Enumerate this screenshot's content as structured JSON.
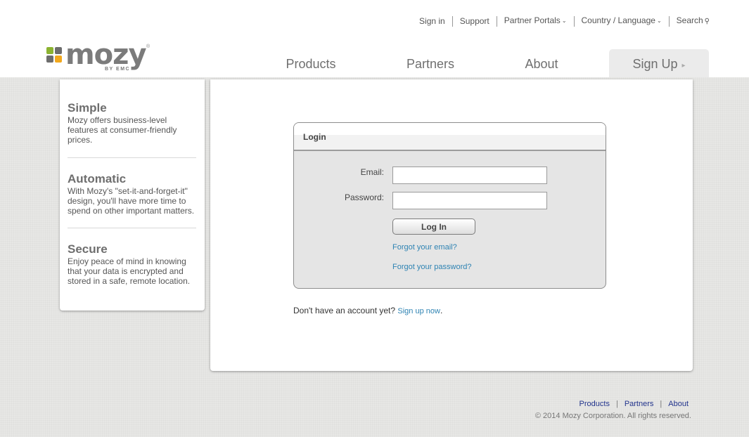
{
  "utility_nav": {
    "sign_in": "Sign in",
    "support": "Support",
    "partner_portals": "Partner Portals",
    "country_language": "Country / Language",
    "search": "Search"
  },
  "logo": {
    "wordmark": "mozy",
    "byline": "BY EMC",
    "registered": "®",
    "square_colors": [
      "#8cb331",
      "#6d6d6d",
      "#6d6d6d",
      "#f2a81d"
    ]
  },
  "main_nav": {
    "products": "Products",
    "partners": "Partners",
    "about": "About",
    "sign_up": "Sign Up"
  },
  "sidebar": {
    "features": [
      {
        "title": "Simple",
        "text": "Mozy offers business-level features at consumer-friendly prices."
      },
      {
        "title": "Automatic",
        "text": "With Mozy's \"set-it-and-forget-it\" design, you'll have more time to spend on other important matters."
      },
      {
        "title": "Secure",
        "text": "Enjoy peace of mind in knowing that your data is encrypted and stored in a safe, remote location."
      }
    ]
  },
  "login": {
    "heading": "Login",
    "email_label": "Email:",
    "email_value": "",
    "password_label": "Password:",
    "password_value": "",
    "button_label": "Log In",
    "forgot_email": "Forgot your email?",
    "forgot_password": "Forgot your password?"
  },
  "signup_prompt": {
    "text": "Don't have an account yet? ",
    "link": "Sign up now",
    "trailing": "."
  },
  "footer": {
    "products": "Products",
    "partners": "Partners",
    "about": "About",
    "separator": "|",
    "copyright": "© 2014 Mozy Corporation. All rights reserved."
  },
  "colors": {
    "link_blue": "#2e83b3",
    "footer_link": "#21338c",
    "logo_gray": "#7b7b7b",
    "page_background": "#e7e7e5"
  },
  "icons": {
    "dropdown": "chevron-down-icon",
    "search": "magnifier-icon",
    "signup_arrow": "dotted-arrow-icon"
  }
}
